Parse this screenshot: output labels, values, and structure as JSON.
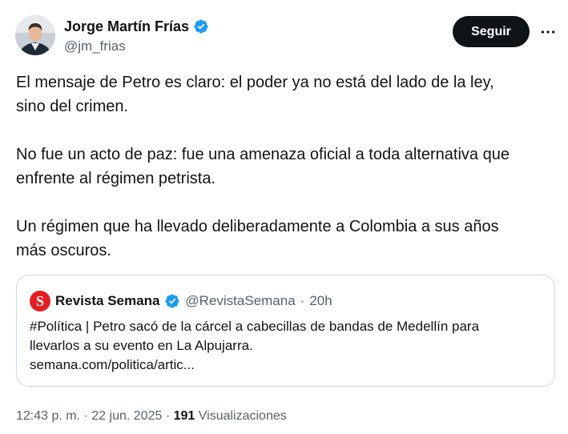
{
  "author": {
    "name": "Jorge Martín Frías",
    "handle": "@jm_frias",
    "verified_icon": "verified-badge-icon"
  },
  "actions": {
    "follow_label": "Seguir",
    "more_icon": "more-icon"
  },
  "tweet": {
    "paragraphs": [
      {
        "lines": [
          "El mensaje de Petro es claro: el poder ya no está del lado de la ley,",
          "sino del crimen."
        ]
      },
      {
        "lines": [
          "No fue un acto de paz: fue una amenaza oficial a toda alternativa que",
          "enfrente al régimen petrista."
        ]
      },
      {
        "lines": [
          "Un régimen que ha llevado deliberadamente a Colombia a sus años",
          "más oscuros."
        ]
      }
    ]
  },
  "quoted": {
    "logo_letter": "S",
    "name": "Revista Semana",
    "handle": "@RevistaSemana",
    "separator": "·",
    "time": "20h",
    "lines": [
      "#Política | Petro sacó de la cárcel a cabecillas de bandas de Medellín para",
      "llevarlos a su evento en La Alpujarra.",
      "semana.com/politica/artic..."
    ]
  },
  "footer": {
    "time": "12:43 p. m.",
    "sep1": "·",
    "date": "22 jun. 2025",
    "sep2": "·",
    "views_count": "191",
    "views_label": "Visualizaciones"
  },
  "colors": {
    "text": "#0f1419",
    "secondary": "#536471",
    "verified": "#1d9bf0",
    "border": "#cfd9de",
    "semana_red": "#e31e24"
  }
}
